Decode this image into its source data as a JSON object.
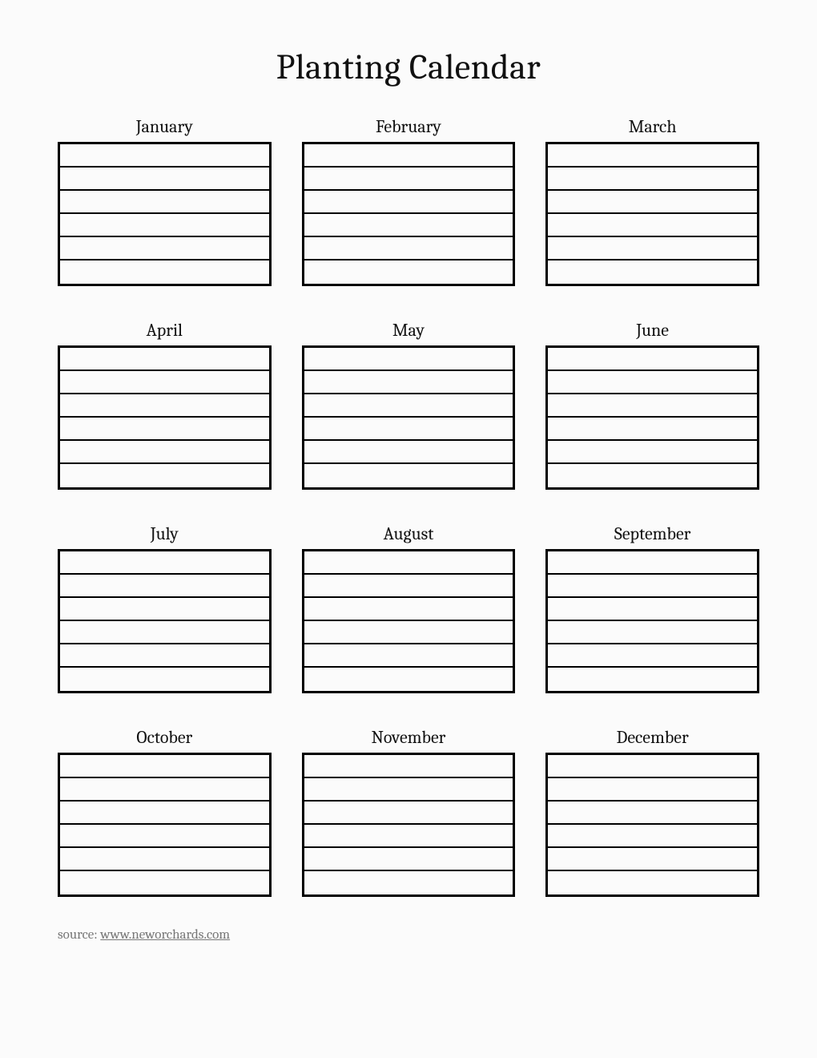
{
  "title": "Planting Calendar",
  "rows_per_month": 6,
  "months": [
    {
      "label": "January"
    },
    {
      "label": "February"
    },
    {
      "label": "March"
    },
    {
      "label": "April"
    },
    {
      "label": "May"
    },
    {
      "label": "June"
    },
    {
      "label": "July"
    },
    {
      "label": "August"
    },
    {
      "label": "September"
    },
    {
      "label": "October"
    },
    {
      "label": "November"
    },
    {
      "label": "December"
    }
  ],
  "footer": {
    "label": "source: ",
    "link_text": "www.neworchards.com"
  }
}
